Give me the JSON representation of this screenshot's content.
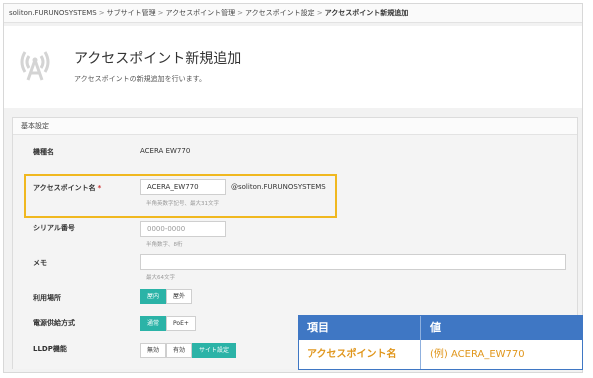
{
  "breadcrumb": {
    "items": [
      "soliton.FURUNOSYSTEMS",
      "サブサイト管理",
      "アクセスポイント管理",
      "アクセスポイント設定"
    ],
    "current": "アクセスポイント新規追加",
    "separator": ">"
  },
  "header": {
    "title": "アクセスポイント新規追加",
    "subtitle": "アクセスポイントの新規追加を行います。"
  },
  "section": {
    "title": "基本設定",
    "fields": {
      "model": {
        "label": "機種名",
        "value": "ACERA EW770"
      },
      "ap_name": {
        "label": "アクセスポイント名",
        "required_mark": "*",
        "value": "ACERA_EW770",
        "suffix": "@soliton.FURUNOSYSTEMS",
        "hint": "半角英数字記号、最大31文字"
      },
      "serial": {
        "label": "シリアル番号",
        "placeholder": "0000-0000",
        "hint": "半角数字、8桁"
      },
      "memo": {
        "label": "メモ",
        "value": "",
        "hint": "最大64文字"
      },
      "location": {
        "label": "利用場所",
        "options": [
          "屋内",
          "屋外"
        ],
        "selected": "屋内"
      },
      "power": {
        "label": "電源供給方式",
        "options": [
          "通常",
          "PoE+"
        ],
        "selected": "通常"
      },
      "lldp": {
        "label": "LLDP機能",
        "options": [
          "無効",
          "有効",
          "サイト設定"
        ],
        "selected": "サイト設定"
      }
    }
  },
  "table": {
    "headers": [
      "項目",
      "値"
    ],
    "row": [
      "アクセスポイント名",
      "(例) ACERA_EW770"
    ]
  },
  "colors": {
    "accent": "#2bb3a7",
    "highlight": "#f0b820",
    "table_header": "#3f77c4",
    "table_text": "#e0961c"
  },
  "icons": {
    "header": "wifi-antenna-icon"
  }
}
